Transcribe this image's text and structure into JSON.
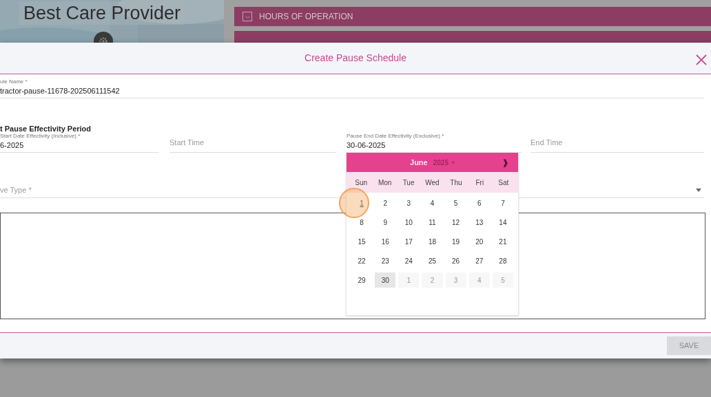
{
  "background": {
    "provider_name": "Best Care Provider",
    "menu": [
      {
        "label": "HOURS OF OPERATION"
      }
    ]
  },
  "dialog": {
    "title": "Create Pause Schedule",
    "schedule_name": {
      "label": "ule Name *",
      "value": "tractor-pause-11678-202506111542"
    },
    "section_heading": "t Pause Effectivity Period",
    "period_fields": [
      {
        "label": "Start Date Effectivity (Inclusive) *",
        "value": "6-2025"
      },
      {
        "placeholder": "Start Time"
      },
      {
        "label": "Pause End Date Effectivity (Exclusive) *",
        "value": "30-06-2025"
      },
      {
        "placeholder": "End Time"
      }
    ],
    "type_select": {
      "placeholder": "ve Type *"
    },
    "calendar": {
      "month": "June",
      "year": "2025",
      "next": "❱",
      "weekdays": [
        "Sun",
        "Mon",
        "Tue",
        "Wed",
        "Thu",
        "Fri",
        "Sat"
      ],
      "days": [
        {
          "label": "1",
          "kind": "current",
          "selected": false,
          "today": true
        },
        {
          "label": "2",
          "kind": "current",
          "selected": false,
          "today": false
        },
        {
          "label": "3",
          "kind": "current",
          "selected": false,
          "today": false
        },
        {
          "label": "4",
          "kind": "current",
          "selected": false,
          "today": false
        },
        {
          "label": "5",
          "kind": "current",
          "selected": false,
          "today": false
        },
        {
          "label": "6",
          "kind": "current",
          "selected": false,
          "today": false
        },
        {
          "label": "7",
          "kind": "current",
          "selected": false,
          "today": false
        },
        {
          "label": "8",
          "kind": "current",
          "selected": false,
          "today": false
        },
        {
          "label": "9",
          "kind": "current",
          "selected": false,
          "today": false
        },
        {
          "label": "10",
          "kind": "current",
          "selected": false,
          "today": false
        },
        {
          "label": "11",
          "kind": "current",
          "selected": false,
          "today": false
        },
        {
          "label": "12",
          "kind": "current",
          "selected": false,
          "today": false
        },
        {
          "label": "13",
          "kind": "current",
          "selected": false,
          "today": false
        },
        {
          "label": "14",
          "kind": "current",
          "selected": false,
          "today": false
        },
        {
          "label": "15",
          "kind": "current",
          "selected": false,
          "today": false
        },
        {
          "label": "16",
          "kind": "current",
          "selected": false,
          "today": false
        },
        {
          "label": "17",
          "kind": "current",
          "selected": false,
          "today": false
        },
        {
          "label": "18",
          "kind": "current",
          "selected": false,
          "today": false
        },
        {
          "label": "19",
          "kind": "current",
          "selected": false,
          "today": false
        },
        {
          "label": "20",
          "kind": "current",
          "selected": false,
          "today": false
        },
        {
          "label": "21",
          "kind": "current",
          "selected": false,
          "today": false
        },
        {
          "label": "22",
          "kind": "current",
          "selected": false,
          "today": false
        },
        {
          "label": "23",
          "kind": "current",
          "selected": false,
          "today": false
        },
        {
          "label": "24",
          "kind": "current",
          "selected": false,
          "today": false
        },
        {
          "label": "25",
          "kind": "current",
          "selected": false,
          "today": false
        },
        {
          "label": "26",
          "kind": "current",
          "selected": false,
          "today": false
        },
        {
          "label": "27",
          "kind": "current",
          "selected": false,
          "today": false
        },
        {
          "label": "28",
          "kind": "current",
          "selected": false,
          "today": false
        },
        {
          "label": "29",
          "kind": "current",
          "selected": false,
          "today": false
        },
        {
          "label": "30",
          "kind": "current",
          "selected": true,
          "today": false
        },
        {
          "label": "1",
          "kind": "other",
          "selected": false,
          "today": false
        },
        {
          "label": "2",
          "kind": "other",
          "selected": false,
          "today": false
        },
        {
          "label": "3",
          "kind": "other",
          "selected": false,
          "today": false
        },
        {
          "label": "4",
          "kind": "other",
          "selected": false,
          "today": false
        },
        {
          "label": "5",
          "kind": "other",
          "selected": false,
          "today": false
        }
      ]
    },
    "save_button": {
      "label": "SAVE",
      "disabled": true
    }
  }
}
